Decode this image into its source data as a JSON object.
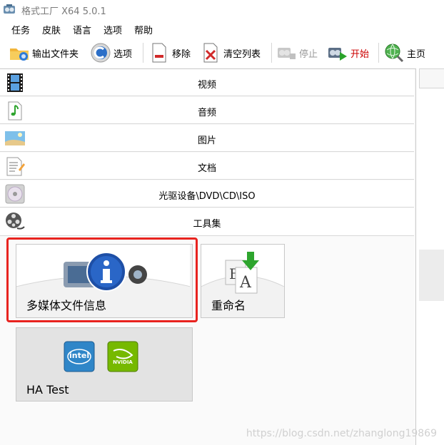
{
  "window": {
    "title": "格式工厂 X64 5.0.1"
  },
  "menu": [
    "任务",
    "皮肤",
    "语言",
    "选项",
    "帮助"
  ],
  "toolbar": {
    "output_folder": "输出文件夹",
    "options": "选项",
    "remove": "移除",
    "clear_list": "清空列表",
    "stop": "停止",
    "start": "开始",
    "home": "主页"
  },
  "categories": {
    "video": "视频",
    "audio": "音频",
    "image": "图片",
    "document": "文档",
    "disc": "光驱设备\\DVD\\CD\\ISO",
    "tools": "工具集"
  },
  "tools": {
    "media_info": "多媒体文件信息",
    "rename": "重命名",
    "ha_test": "HA Test",
    "ha_test_logos": {
      "intel": "intel",
      "nvidia": "NVIDIA"
    }
  },
  "watermark": "https://blog.csdn.net/zhanglong19869",
  "colors": {
    "highlight": "#e8231f",
    "start": "#cc0000"
  }
}
